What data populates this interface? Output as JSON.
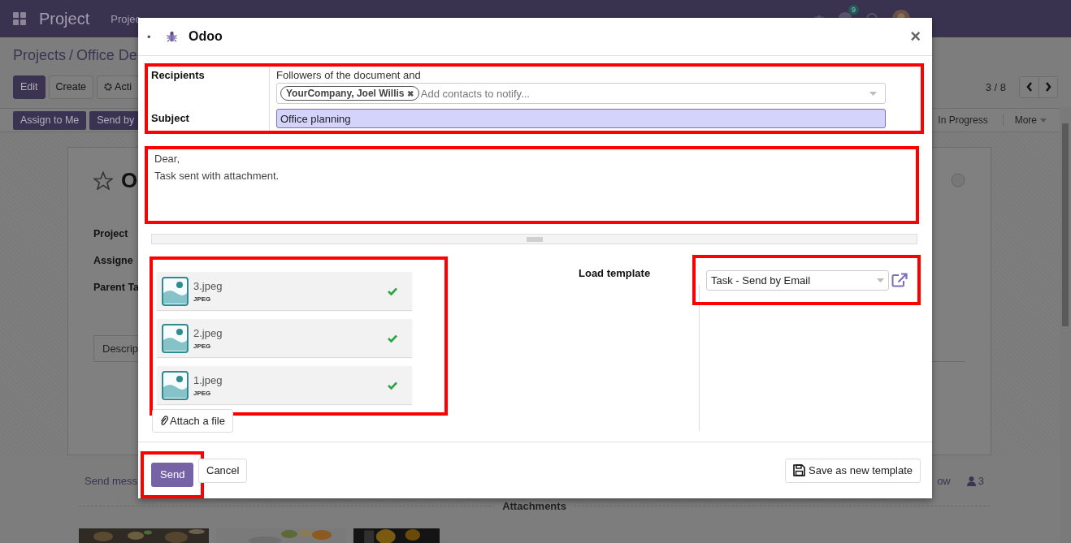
{
  "navbar": {
    "app_name": "Project",
    "menu": [
      "Projec"
    ],
    "chat_count": "9"
  },
  "breadcrumb": {
    "items": [
      "Projects",
      "Office De"
    ],
    "separator": "/"
  },
  "control_panel": {
    "buttons": [
      "Edit",
      "Create"
    ],
    "action_menu": "Acti",
    "pager": "3 / 8"
  },
  "status_bar": {
    "buttons": [
      "Assign to Me",
      "Send by"
    ],
    "stages": [
      "In Progress",
      "More"
    ]
  },
  "record": {
    "title": "O",
    "fields": [
      "Project",
      "Assigne",
      "Parent Ta"
    ],
    "tab": "Descrip"
  },
  "chatter": {
    "send_message": "Send mess",
    "follow": "ow",
    "followers": "3",
    "attachments_title": "Attachments"
  },
  "dialog": {
    "bullet": "•",
    "title": "Odoo",
    "close": "×",
    "recipients_label": "Recipients",
    "recipients_note": "Followers of the document and",
    "recipient_tags": [
      {
        "label": "YourCompany, Joel Willis",
        "remove": "✖"
      }
    ],
    "recipients_placeholder": "Add contacts to notify...",
    "subject_label": "Subject",
    "subject": "Office planning",
    "body": [
      "Dear,",
      "Task sent with attachment."
    ],
    "attachments": [
      {
        "name": "3.jpeg",
        "type": "JPEG",
        "uploaded": true
      },
      {
        "name": "2.jpeg",
        "type": "JPEG",
        "uploaded": true
      },
      {
        "name": "1.jpeg",
        "type": "JPEG",
        "uploaded": true
      }
    ],
    "attach_button": "Attach a file",
    "template_label": "Load template",
    "template": "Task - Send by Email",
    "send": "Send",
    "cancel": "Cancel",
    "save_template": "Save as new template"
  }
}
